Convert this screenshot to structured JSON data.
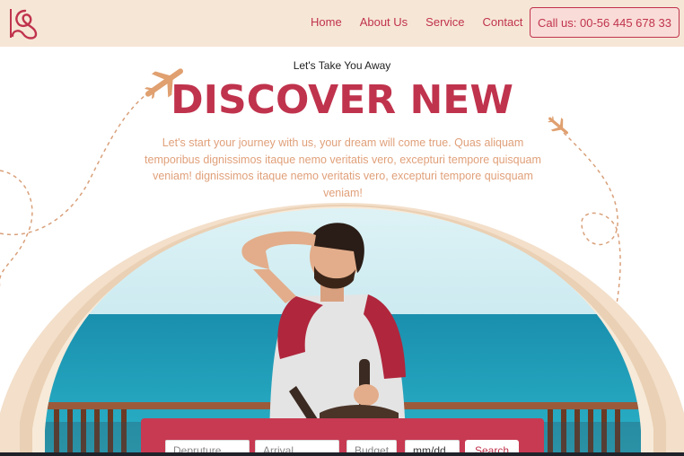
{
  "header": {
    "nav": [
      {
        "label": "Home"
      },
      {
        "label": "About Us"
      },
      {
        "label": "Service"
      },
      {
        "label": "Contact"
      }
    ],
    "call_label": "Call us: 00-56 445 678 33"
  },
  "hero": {
    "tagline": "Let's Take You Away",
    "headline": "DISCOVER NEW",
    "description": "Let's start your journey with us, your dream will come true. Quas aliquam temporibus dignissimos itaque nemo veritatis vero, excepturi tempore quisquam veniam! dignissimos itaque nemo veritatis vero, excepturi tempore quisquam veniam!"
  },
  "search": {
    "departure_placeholder": "Depruture",
    "arrival_placeholder": "Arrival",
    "budget_placeholder": "Budget",
    "date_placeholder": "mm/dd",
    "search_label": "Search"
  },
  "colors": {
    "accent": "#c0334d",
    "header_bg": "#f6e6d6",
    "description": "#e0a07a",
    "arch": "#f3dfca",
    "sea": "#1e9fb8"
  },
  "icons": [
    "logo-icon",
    "airplane-icon"
  ]
}
